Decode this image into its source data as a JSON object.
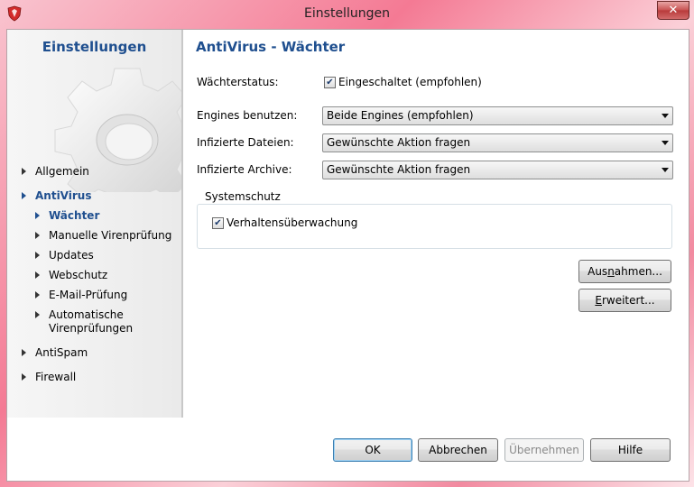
{
  "window": {
    "title": "Einstellungen",
    "close_glyph": "✕"
  },
  "colors": {
    "accent": "#1f4f8f",
    "close": "#c75050"
  },
  "sidebar": {
    "title": "Einstellungen",
    "items": [
      {
        "label": "Allgemein"
      },
      {
        "label": "AntiVirus"
      },
      {
        "label": "Wächter"
      },
      {
        "label": "Manuelle Virenprüfung"
      },
      {
        "label": "Updates"
      },
      {
        "label": "Webschutz"
      },
      {
        "label": "E-Mail-Prüfung"
      },
      {
        "label": "Automatische"
      },
      {
        "label": "Virenprüfungen"
      },
      {
        "label": "AntiSpam"
      },
      {
        "label": "Firewall"
      }
    ]
  },
  "main": {
    "title": "AntiVirus - Wächter",
    "guard_status": {
      "label": "Wächterstatus:",
      "checkbox_label": "Eingeschaltet (empfohlen)",
      "checked": true
    },
    "engines": {
      "label": "Engines benutzen:",
      "value": "Beide Engines (empfohlen)"
    },
    "infected_files": {
      "label": "Infizierte Dateien:",
      "value": "Gewünschte Aktion fragen"
    },
    "infected_archives": {
      "label": "Infizierte Archive:",
      "value": "Gewünschte Aktion fragen"
    },
    "system_protection": {
      "legend": "Systemschutz",
      "behavior": {
        "label": "Verhaltensüberwachung",
        "checked": true
      }
    },
    "exceptions_button": {
      "pre": "Aus",
      "key": "n",
      "post": "ahmen..."
    },
    "advanced_button": {
      "pre": "",
      "key": "E",
      "post": "rweitert..."
    }
  },
  "footer": {
    "ok": "OK",
    "cancel": "Abbrechen",
    "apply": "Übernehmen",
    "help": "Hilfe"
  },
  "icons": [
    "shield-icon",
    "gear-icon",
    "close-icon",
    "checkmark-icon",
    "triangle-right-icon",
    "dropdown-arrow-icon"
  ]
}
